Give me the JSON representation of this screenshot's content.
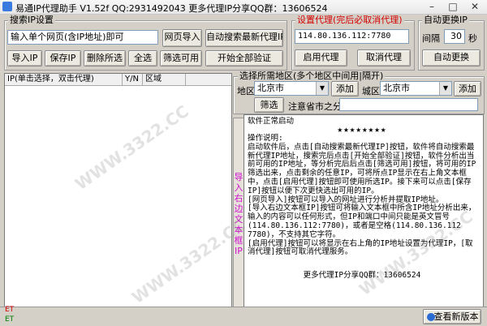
{
  "window": {
    "title": "易通IP代理助手 V1.52f  QQ:2931492043    更多代理IP分享QQ群：13606524",
    "minimize": "–",
    "maximize": "□",
    "close": "✕"
  },
  "search_group": {
    "label": "搜索IP设置",
    "url_input": "输入单个网页(含IP地址)即可",
    "import_page_btn": "网页导入",
    "auto_search_btn": "自动搜索最新代理IP",
    "import_ip_btn": "导入IP",
    "save_ip_btn": "保存IP",
    "delete_selected_btn": "删除所选",
    "select_all_btn": "全选",
    "filter_usable_btn": "筛选可用",
    "start_verify_btn": "开始全部验证"
  },
  "proxy_group": {
    "label": "设置代理(完后必取消代理)",
    "ip_value": "114.80.136.112:7780",
    "enable_btn": "启用代理",
    "cancel_btn": "取消代理"
  },
  "autochange_group": {
    "label": "自动更换IP",
    "interval_label": "间隔",
    "interval_value": "30",
    "unit": "秒",
    "auto_change_btn": "自动更换"
  },
  "ip_list": {
    "col_ip": "IP(单击选择，双击代理)",
    "col_yn": "Y/N",
    "col_region": "区域"
  },
  "region_group": {
    "label": "选择所需地区(多个地区中间用|隔开)",
    "area1_label": "地区",
    "area1_value": "北京市",
    "add1_btn": "添加",
    "area2_label": "城区",
    "area2_value": "北京市",
    "add2_btn": "添加",
    "filter_btn": "筛选",
    "note": "注意省市之分"
  },
  "side_tab": "导入右边文本框IP",
  "log": {
    "status": "软件正常启动",
    "stars": "★★★★★★★★",
    "body": "操作说明:\n启动软件后，点击[自动搜索最新代理IP]按钮，软件将自动搜索最新代理IP地址，搜索完后点击[开始全部验证]按钮，软件分析出当前可用的IP地址，等分析完后后点击[筛选可用]按钮，将可用的IP筛选出来，点击剩余的任意IP，可将所点IP显示在右上角文本框中，点击[启用代理]按钮即可使用所选IP。接下来可以点击[保存IP]按钮以便下次更快选出可用的IP。\n[网页导入]按钮可以导入的网址进行分析并提取IP地址。\n[导入右边文本框IP]按钮可将输入文本框中所含IP地址分析出来，输入的内容可以任何形式，但IP和端口中间只能是英文冒号(114.80.136.112:7780)，或者是空格(114.80.136.112 7780)，不支持其它字符。\n[启用代理]按钮可以将显示在右上角的IP地址设置为代理IP，[取消代理]按钮可取消代理服务。",
    "footer": "更多代理IP分享QQ群：13606524"
  },
  "status": {
    "et1": "ET",
    "et2": "ET",
    "update_btn": "查看新版本"
  },
  "watermark": {
    "text": "WWW.3322.CC"
  },
  "colors": {
    "red_label": "#d40000",
    "side_tab_text": "#d010d0"
  }
}
